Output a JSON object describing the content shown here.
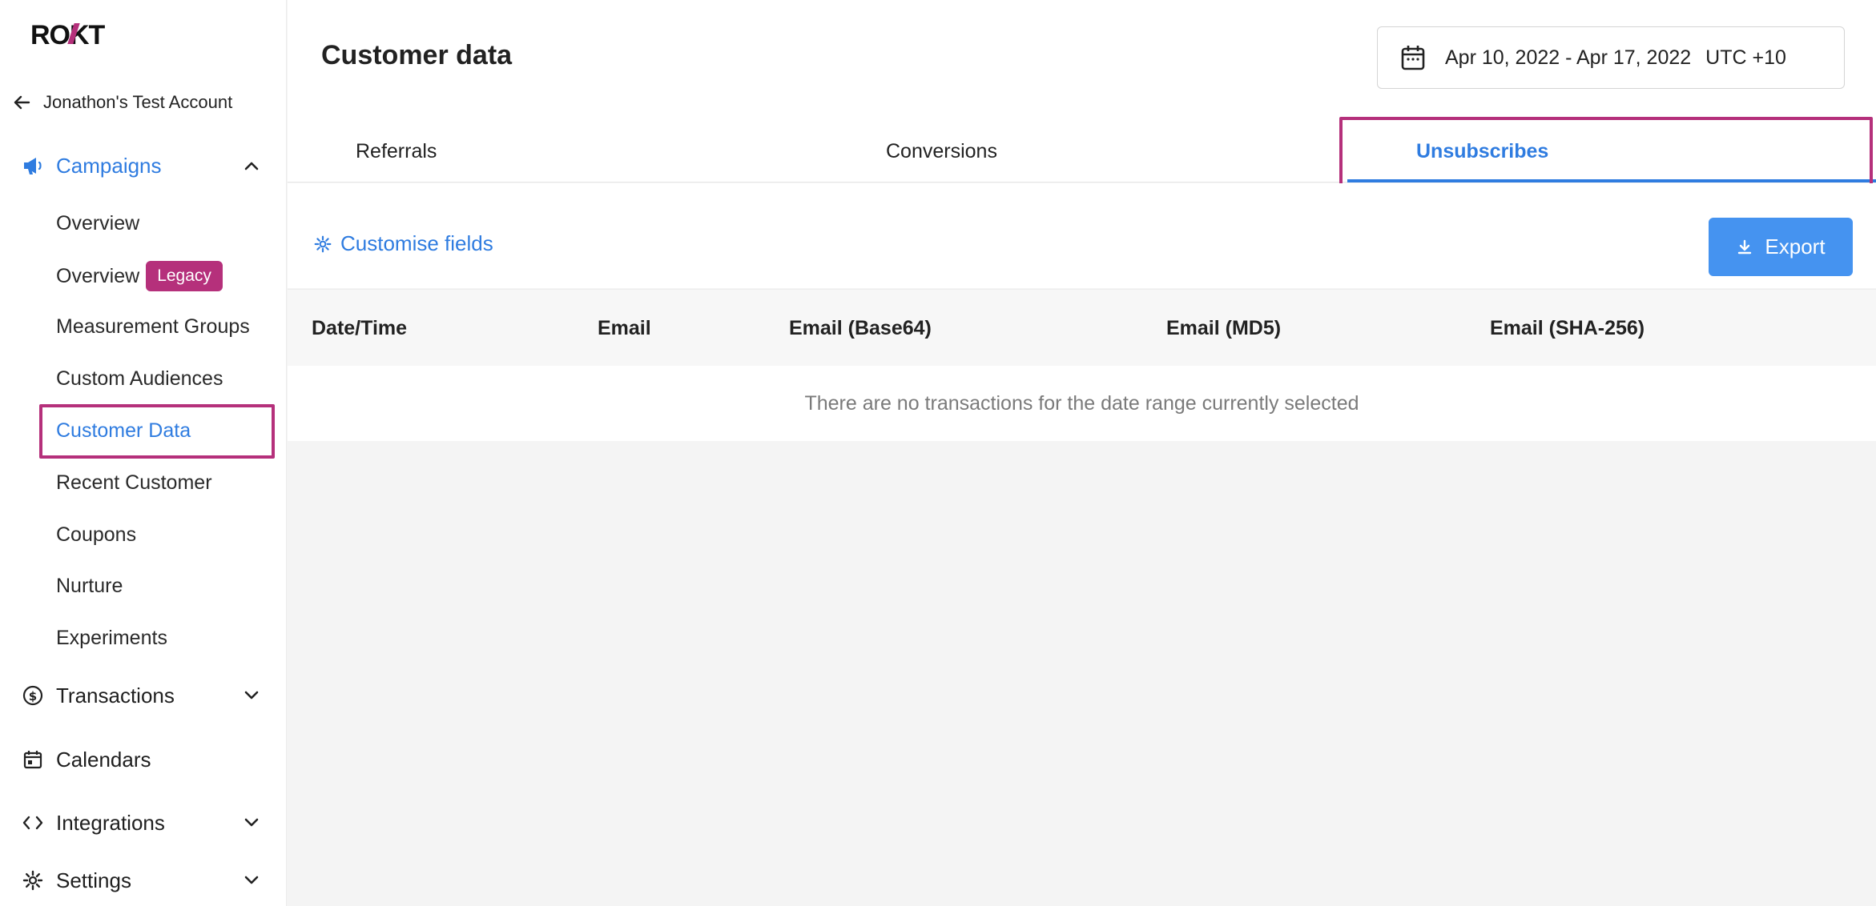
{
  "sidebar": {
    "logo_text": "ROKT",
    "account_name": "Jonathon's Test Account",
    "groups": {
      "campaigns": {
        "label": "Campaigns",
        "icon": "megaphone-icon",
        "expanded": true
      },
      "transactions": {
        "label": "Transactions",
        "icon": "dollar-circle-icon"
      },
      "calendars": {
        "label": "Calendars",
        "icon": "calendar-icon"
      },
      "integrations": {
        "label": "Integrations",
        "icon": "code-icon"
      },
      "settings": {
        "label": "Settings",
        "icon": "gear-icon"
      }
    },
    "campaign_items": [
      {
        "label": "Overview"
      },
      {
        "label": "Overview",
        "badge": "Legacy"
      },
      {
        "label": "Measurement Groups"
      },
      {
        "label": "Custom Audiences"
      },
      {
        "label": "Customer Data",
        "active": true
      },
      {
        "label": "Recent Customer"
      },
      {
        "label": "Coupons"
      },
      {
        "label": "Nurture"
      },
      {
        "label": "Experiments"
      }
    ]
  },
  "header": {
    "title": "Customer data",
    "date_range": "Apr 10, 2022 - Apr 17, 2022",
    "timezone": "UTC +10"
  },
  "tabs": [
    {
      "label": "Referrals"
    },
    {
      "label": "Conversions"
    },
    {
      "label": "Unsubscribes",
      "active": true
    }
  ],
  "toolbar": {
    "customise_label": "Customise fields",
    "export_label": "Export"
  },
  "table": {
    "columns": [
      "Date/Time",
      "Email",
      "Email (Base64)",
      "Email (MD5)",
      "Email (SHA-256)"
    ],
    "empty_message": "There are no transactions for the date range currently selected"
  },
  "colors": {
    "accent": "#2f7ce0",
    "highlight": "#b5307b",
    "export_button": "#4593f0"
  }
}
